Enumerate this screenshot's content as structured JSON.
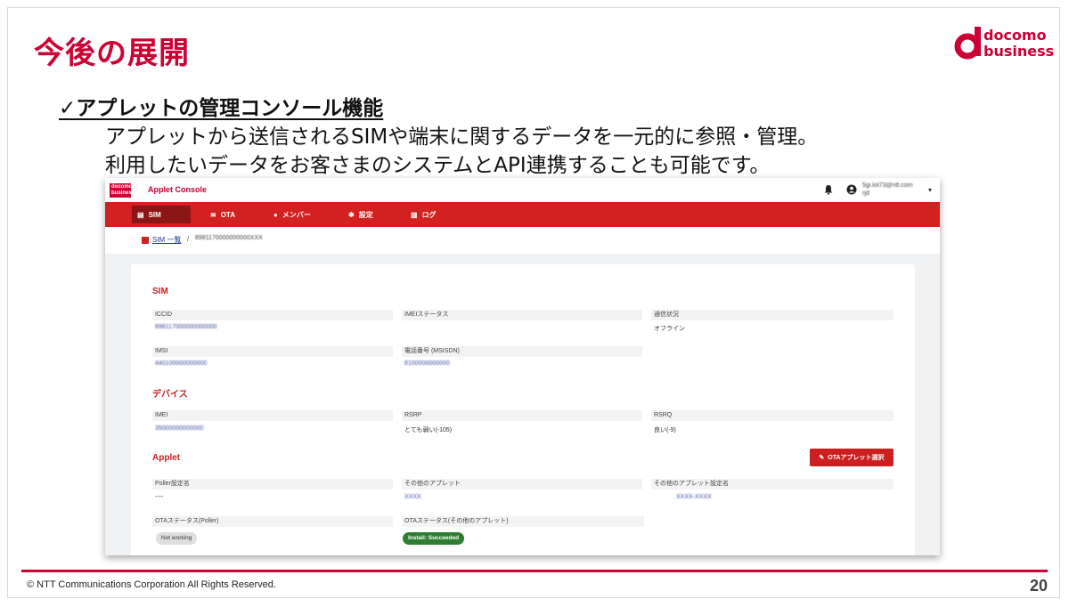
{
  "slide": {
    "title": "今後の展開",
    "feature_heading": "✓アプレットの管理コンソール機能",
    "description_line1": "アプレットから送信されるSIMや端末に関するデータを一元的に参照・管理。",
    "description_line2": "利用したいデータをお客さまのシステムとAPI連携することも可能です。",
    "copyright": "© NTT Communications Corporation All Rights Reserved.",
    "page_number": "20",
    "brand_color": "#cc0033"
  },
  "logo": {
    "line1": "docomo",
    "line2": "business",
    "mark": "d"
  },
  "app": {
    "mini_logo": "docomo business",
    "title": "Applet Console",
    "user_email": "5gi.lot73@ntt.com",
    "user_sub": "rjd",
    "tabs": [
      {
        "label": "SIM",
        "icon": "sim-icon",
        "glyph": "▤"
      },
      {
        "label": "OTA",
        "icon": "wifi-icon",
        "glyph": "≋"
      },
      {
        "label": "メンバー",
        "icon": "person-icon",
        "glyph": "●"
      },
      {
        "label": "設定",
        "icon": "gear-icon",
        "glyph": "✱"
      },
      {
        "label": "ログ",
        "icon": "log-icon",
        "glyph": "▥"
      }
    ],
    "breadcrumb": {
      "link": "SIM 一覧",
      "sep": "/",
      "current": "8981170000000000XXX"
    },
    "sections": {
      "sim": "SIM",
      "device": "デバイス",
      "applet": "Applet"
    },
    "sim_fields": {
      "iccid_label": "ICCID",
      "iccid_value": "898117000000000000",
      "imei_status_label": "IMEIステータス",
      "imei_status_value": "",
      "comm_label": "通信状況",
      "comm_value": "オフライン",
      "imsi_label": "IMSI",
      "imsi_value": "440100000000000",
      "msisdn_label": "電話番号 (MSISDN)",
      "msisdn_value": "8100000000000"
    },
    "device_fields": {
      "imei_label": "IMEI",
      "imei_value": "35000000000000",
      "rsrp_label": "RSRP",
      "rsrp_value": "とても弱い(-105)",
      "rsrq_label": "RSRQ",
      "rsrq_value": "良い(-9)"
    },
    "applet_fields": {
      "ota_button": "OTAアプレット選択",
      "poller_label": "Poller設定名",
      "poller_value": "----",
      "other_applet_label": "その他のアプレット",
      "other_applet_value": "XXXX",
      "other_applet_setting_label": "その他のアプレット設定名",
      "other_applet_setting_value": "XXXX-XXXX",
      "ota_poller_label": "OTAステータス(Poller)",
      "ota_poller_value": "Not working",
      "ota_other_label": "OTAステータス(その他のアプレット)",
      "ota_other_value": "Install: Succeeded"
    }
  }
}
